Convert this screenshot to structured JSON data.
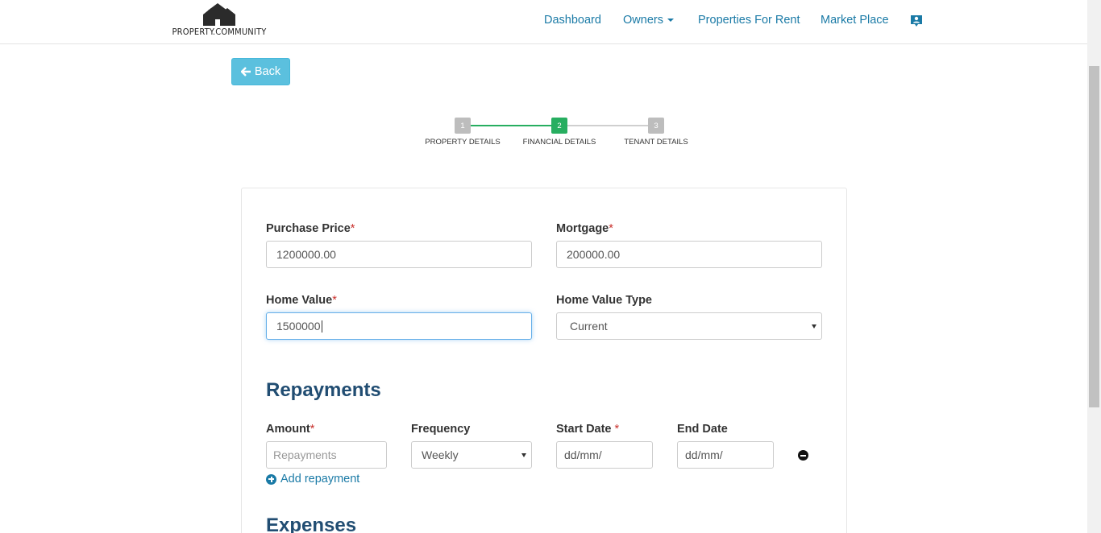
{
  "app": {
    "logo_text": "PROPERTY.COMMUNITY"
  },
  "nav": {
    "dashboard": "Dashboard",
    "owners": "Owners",
    "properties_for_rent": "Properties For Rent",
    "market_place": "Market Place",
    "profile_icon": "contact-card-icon"
  },
  "back_button": {
    "label": "Back",
    "icon": "arrow-left-icon"
  },
  "stepper": {
    "steps": [
      {
        "number": "1",
        "label": "PROPERTY DETAILS",
        "state": "completed"
      },
      {
        "number": "2",
        "label": "FINANCIAL DETAILS",
        "state": "active"
      },
      {
        "number": "3",
        "label": "TENANT DETAILS",
        "state": "pending"
      }
    ],
    "colors": {
      "active": "#27ae60",
      "inactive": "#bdbdbd"
    }
  },
  "form": {
    "purchase_price": {
      "label": "Purchase Price",
      "required": "*",
      "value": "1200000.00"
    },
    "mortgage": {
      "label": "Mortgage",
      "required": "*",
      "value": "200000.00"
    },
    "home_value": {
      "label": "Home Value",
      "required": "*",
      "value": "1500000"
    },
    "home_value_type": {
      "label": "Home Value Type",
      "selected": "Current"
    }
  },
  "repayments": {
    "title": "Repayments",
    "columns": {
      "amount": {
        "label": "Amount",
        "required": "*"
      },
      "frequency": {
        "label": "Frequency"
      },
      "start_date": {
        "label": "Start Date",
        "required": "*"
      },
      "end_date": {
        "label": "End Date"
      }
    },
    "row": {
      "amount_placeholder": "Repayments",
      "frequency": "Weekly",
      "start_date": "dd/mm/",
      "end_date": "dd/mm/"
    },
    "add_label": "Add repayment"
  },
  "expenses": {
    "title": "Expenses"
  },
  "colors": {
    "link": "#1a7aa6",
    "heading": "#214d72",
    "required": "#c9302c",
    "back_button": "#5bc0de"
  }
}
